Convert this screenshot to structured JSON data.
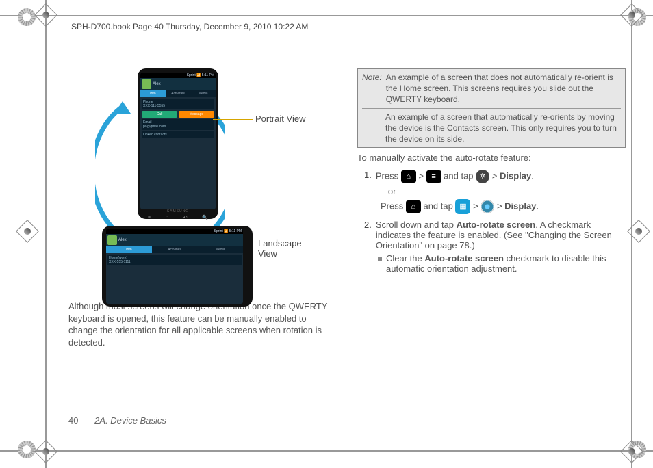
{
  "header": "SPH-D700.book  Page 40  Thursday, December 9, 2010  10:22 AM",
  "figure": {
    "portraitLabel": "Portrait View",
    "landscapeLabel": "Landscape View",
    "statusbar": "5:11 PM",
    "contactName": "Alex",
    "tabs": [
      "Info",
      "Activities",
      "Media"
    ],
    "phoneLabel": "Phone",
    "phoneValue": "XXX-111-5555",
    "callBtn": "Call",
    "msgBtn": "Message",
    "emailLabel": "Email",
    "emailValue": "px@gmail.com",
    "catLabel": "Linked contacts",
    "homeLabel": "Home(work)",
    "homeValue": "XXX-555-1111",
    "brand": "SAMSUNG",
    "carrier": "Sprint"
  },
  "paragraph": "Although most screens will change orientation once the QWERTY keyboard is opened, this feature can be manually enabled to change the orientation for all applicable screens when rotation is detected.",
  "note": {
    "label": "Note:",
    "p1": "An example of a screen that does not automatically re-orient is the Home screen. This screens requires you slide out the QWERTY keyboard.",
    "p2": "An example of a screen that automatically re-orients by moving the device is the Contacts screen. This only requires you to turn the device on its side."
  },
  "lead": "To manually activate the auto-rotate feature:",
  "step1": {
    "num": "1.",
    "a": "Press ",
    "b": " > ",
    "c": " and tap ",
    "d": " > ",
    "display": "Display",
    "dot": ".",
    "or": "– or –",
    "e": "Press ",
    "f": " and tap ",
    "g": " > ",
    "h": " > "
  },
  "step2": {
    "num": "2.",
    "a": "Scroll down and tap ",
    "term": "Auto-rotate screen",
    "b": ". A checkmark indicates the feature is enabled. (See \"Changing the Screen Orientation\" on page 78.)"
  },
  "bullet": {
    "a": "Clear the ",
    "term": "Auto-rotate screen",
    "b": " checkmark to disable this automatic orientation adjustment."
  },
  "footer": {
    "page": "40",
    "section": "2A. Device Basics"
  },
  "icons": {
    "home": "⌂",
    "menu": "≡",
    "gear": "✲",
    "apps": "▦"
  }
}
